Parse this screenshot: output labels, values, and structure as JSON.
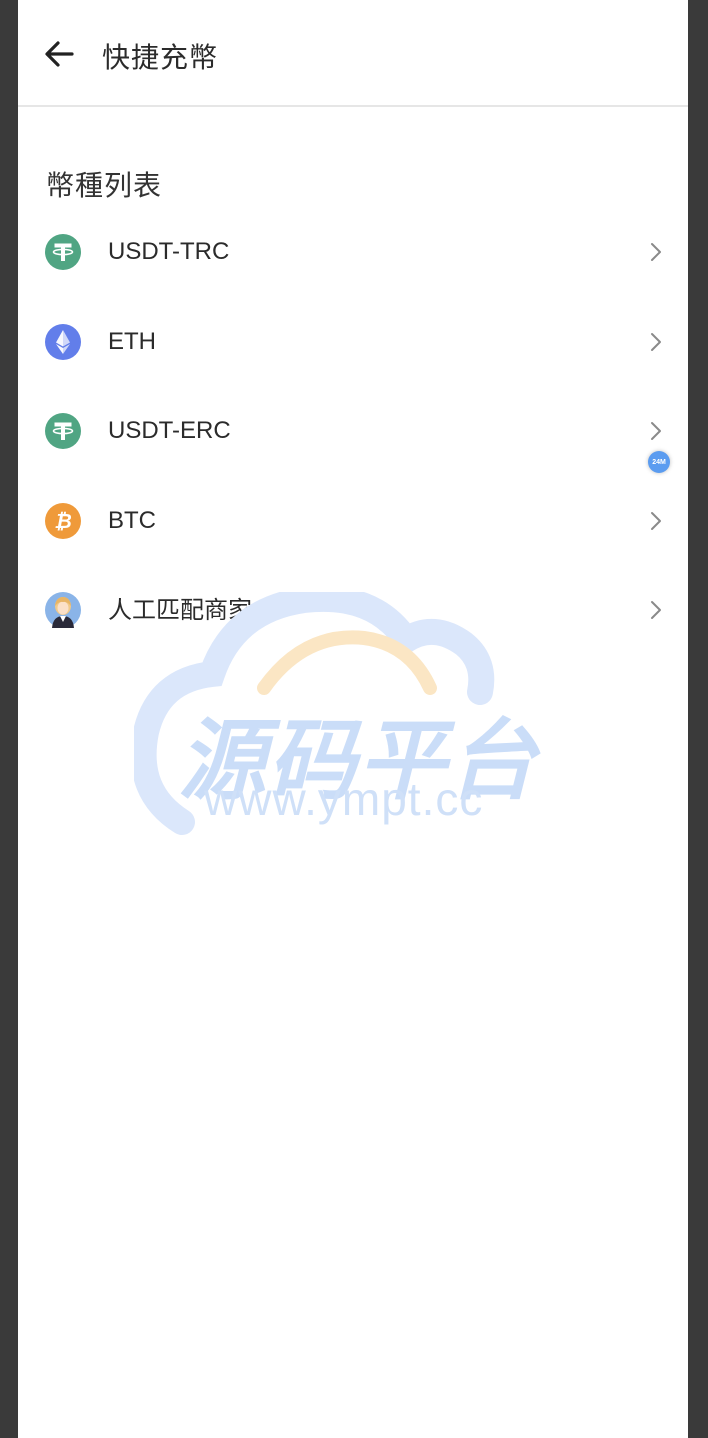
{
  "header": {
    "title": "快捷充幣",
    "back_icon": "arrow-left-icon"
  },
  "section": {
    "title": "幣種列表"
  },
  "coins": [
    {
      "label": "USDT-TRC",
      "icon": "tether-icon",
      "color": "#50a583"
    },
    {
      "label": "ETH",
      "icon": "ethereum-icon",
      "color": "#627eea"
    },
    {
      "label": "USDT-ERC",
      "icon": "tether-icon",
      "color": "#50a583"
    },
    {
      "label": "BTC",
      "icon": "bitcoin-icon",
      "color": "#ef9a3a"
    },
    {
      "label": "人工匹配商家",
      "icon": "agent-avatar-icon",
      "color": "#8ab4e8"
    }
  ],
  "watermark": {
    "cjk": "源码平台",
    "url": "www.ympt.cc"
  },
  "float_badge": {
    "label": "24M"
  }
}
